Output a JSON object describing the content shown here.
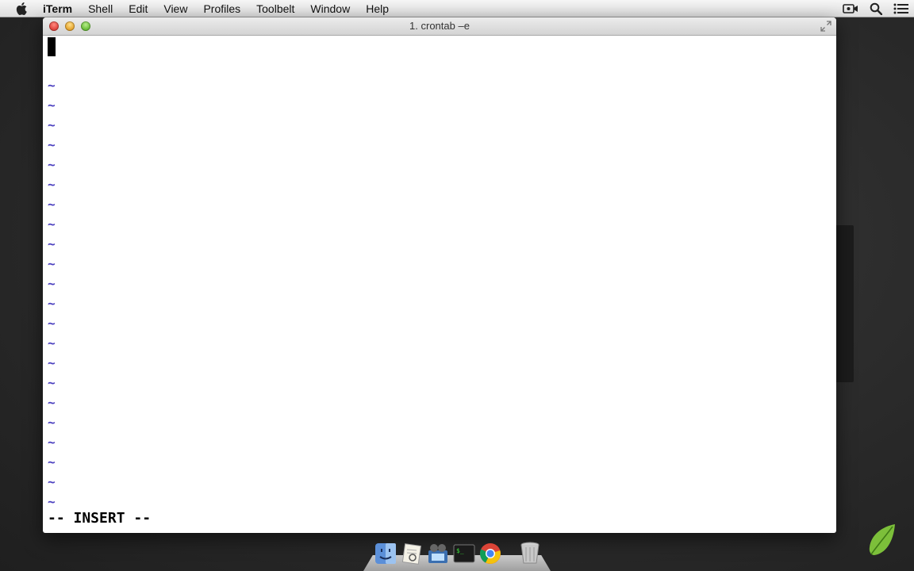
{
  "menubar": {
    "app_name": "iTerm",
    "items": [
      "Shell",
      "Edit",
      "View",
      "Profiles",
      "Toolbelt",
      "Window",
      "Help"
    ],
    "right_icons": [
      "screen-recording-icon",
      "spotlight-search-icon",
      "notification-center-icon"
    ]
  },
  "window": {
    "title": "1. crontab –e"
  },
  "editor": {
    "tilde_char": "~",
    "tilde_lines": 22,
    "mode_line": "-- INSERT --",
    "tilde_color": "#4a3fbf"
  },
  "dock": {
    "apps": [
      "finder-icon",
      "preview-icon",
      "iphoto-slideshow-icon",
      "terminal-icon",
      "chrome-icon"
    ],
    "trash": "trash-icon"
  },
  "colors": {
    "menubar": "#e8e8e8",
    "desktop": "#2a2a2a",
    "terminal_bg": "#ffffff",
    "leaf_green": "#7cbf3a"
  }
}
